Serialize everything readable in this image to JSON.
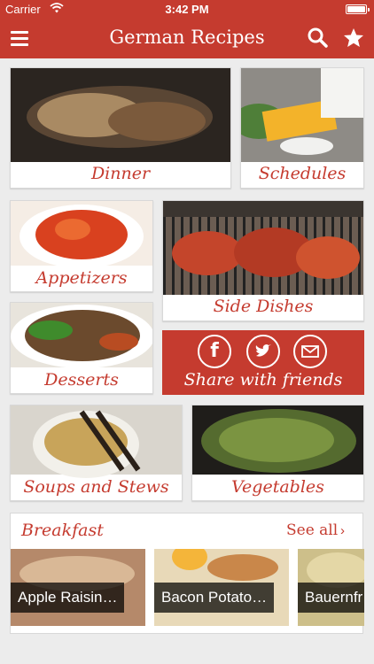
{
  "status_bar": {
    "carrier": "Carrier",
    "time": "3:42 PM"
  },
  "nav": {
    "title": "German Recipes",
    "menu_icon": "hamburger-menu-icon",
    "search_icon": "search-icon",
    "favorites_icon": "star-icon"
  },
  "colors": {
    "accent": "#c53b2f",
    "background": "#ececec"
  },
  "categories": {
    "dinner": "Dinner",
    "schedules": "Schedules",
    "appetizers": "Appetizers",
    "side_dishes": "Side Dishes",
    "desserts": "Desserts",
    "soups": "Soups and Stews",
    "vegetables": "Vegetables"
  },
  "share": {
    "label": "Share with friends",
    "icons": [
      "facebook-icon",
      "twitter-icon",
      "email-icon"
    ]
  },
  "breakfast": {
    "title": "Breakfast",
    "see_all": "See all",
    "items": [
      "Apple Raisin…",
      "Bacon Potato…",
      "Bauernfr"
    ]
  }
}
